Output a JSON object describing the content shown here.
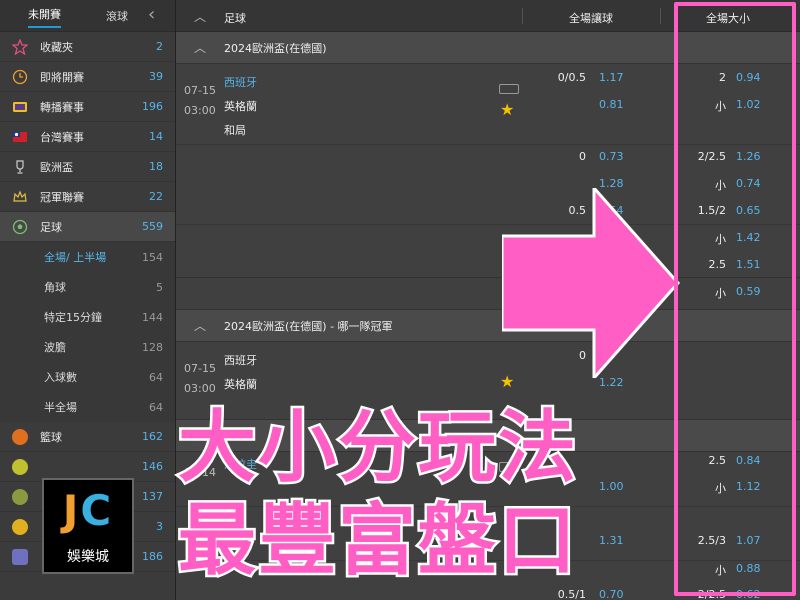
{
  "sidebar": {
    "tabs": {
      "upcoming": "未開賽",
      "live": "滾球"
    },
    "collapse_glyph": "‹",
    "items": [
      {
        "label": "收藏夾",
        "count": "2",
        "icon": "star-outline-icon"
      },
      {
        "label": "即將開賽",
        "count": "39",
        "icon": "clock-icon"
      },
      {
        "label": "轉播賽事",
        "count": "196",
        "icon": "tv-icon"
      },
      {
        "label": "台灣賽事",
        "count": "14",
        "icon": "taiwan-flag-icon"
      },
      {
        "label": "歐洲盃",
        "count": "18",
        "icon": "trophy-icon"
      },
      {
        "label": "冠軍聯賽",
        "count": "22",
        "icon": "crown-icon"
      },
      {
        "label": "足球",
        "count": "559",
        "icon": "soccer-ball-icon"
      }
    ],
    "subitems": [
      {
        "label": "全場/ 上半場",
        "count": "154"
      },
      {
        "label": "角球",
        "count": "5"
      },
      {
        "label": "特定15分鐘",
        "count": "144"
      },
      {
        "label": "波膽",
        "count": "128"
      },
      {
        "label": "入球數",
        "count": "64"
      },
      {
        "label": "半全場",
        "count": "64"
      }
    ],
    "sports": [
      {
        "label": "籃球",
        "count": "162",
        "icon": "basketball-icon"
      },
      {
        "label": "",
        "count": "146",
        "icon": "tennis-ball-icon"
      },
      {
        "label": "",
        "count": "137",
        "icon": "baseball-icon"
      },
      {
        "label": "",
        "count": "3",
        "icon": "volleyball-icon"
      },
      {
        "label": "",
        "count": "186",
        "icon": "esports-icon"
      }
    ]
  },
  "header": {
    "sport": "足球",
    "handicap": "全場讓球",
    "over_under": "全場大小"
  },
  "league1": {
    "name": "2024歐洲盃(在德國)",
    "date": "07-15",
    "time": "03:00",
    "home": "西班牙",
    "away": "英格蘭",
    "draw": "和局",
    "rows": [
      {
        "hcap_line": "0/0.5",
        "hcap_odd": "1.17",
        "ou_line": "2",
        "ou_odd": "0.94"
      },
      {
        "hcap_line": "",
        "hcap_odd": "0.81",
        "ou_line": "小",
        "ou_odd": "1.02"
      },
      {
        "hcap_line": "0",
        "hcap_odd": "0.73",
        "ou_line": "2/2.5",
        "ou_odd": "1.26"
      },
      {
        "hcap_line": "",
        "hcap_odd": "1.28",
        "ou_line": "小",
        "ou_odd": "0.74"
      },
      {
        "hcap_line": "0.5",
        "hcap_odd": "1.54",
        "ou_line": "1.5/2",
        "ou_odd": "0.65"
      },
      {
        "hcap_line": "",
        "hcap_odd": "",
        "ou_line": "小",
        "ou_odd": "1.42"
      },
      {
        "hcap_line": "",
        "hcap_odd": "",
        "ou_line": "2.5",
        "ou_odd": "1.51"
      },
      {
        "hcap_line": "",
        "hcap_odd": "",
        "ou_line": "小",
        "ou_odd": "0.59"
      }
    ]
  },
  "league2": {
    "name": "2024歐洲盃(在德國) - 哪一隊冠軍",
    "date": "07-15",
    "time": "03:00",
    "home": "西班牙",
    "away": "英格蘭",
    "hcap_line": "0",
    "hcap_odd": "1.22"
  },
  "league3": {
    "date": "07-14",
    "home": "烏拉圭",
    "rows": [
      {
        "hcap_line": "",
        "hcap_odd": "",
        "ou_line": "2.5",
        "ou_odd": "0.84"
      },
      {
        "hcap_line": "",
        "hcap_odd": "1.00",
        "ou_line": "小",
        "ou_odd": "1.12"
      },
      {
        "hcap_line": "",
        "hcap_odd": "1.31",
        "ou_line": "2.5/3",
        "ou_odd": "1.07"
      },
      {
        "hcap_line": "",
        "hcap_odd": "",
        "ou_line": "小",
        "ou_odd": "0.88"
      },
      {
        "hcap_line": "0.5/1",
        "hcap_odd": "0.70",
        "ou_line": "2/2.5",
        "ou_odd": "0.62"
      }
    ]
  },
  "overlay": {
    "headline1": "大小分玩法",
    "headline2": "最豐富盤口",
    "accent_color": "#ff5ec4"
  },
  "logo": {
    "letters_j": "J",
    "letters_c": "C",
    "name": "娛樂城"
  }
}
